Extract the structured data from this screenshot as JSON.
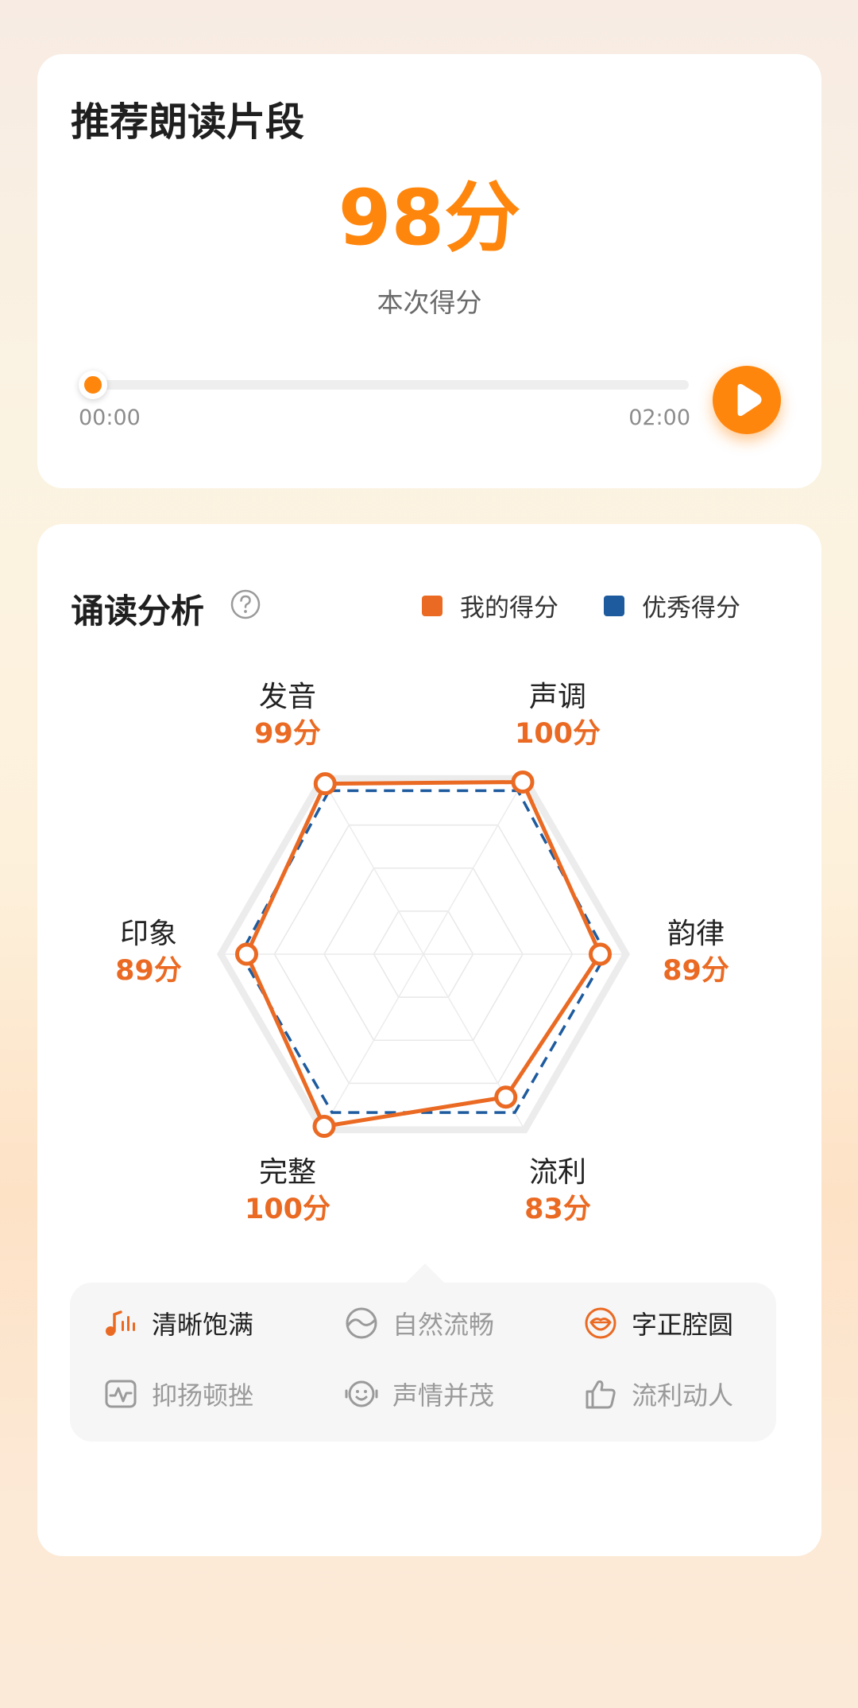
{
  "recommend_card": {
    "title": "推荐朗读片段",
    "score": "98分",
    "score_label": "本次得分",
    "progress_fraction": 0,
    "time_start": "00:00",
    "time_end": "02:00"
  },
  "analysis": {
    "title": "诵读分析",
    "legend": [
      {
        "label": "我的得分",
        "color": "#ea6a23"
      },
      {
        "label": "优秀得分",
        "color": "#1e5b9e"
      }
    ]
  },
  "chart_data": {
    "type": "radar",
    "max": 100,
    "axes": [
      {
        "label": "发音",
        "value": 99,
        "value_label": "99分"
      },
      {
        "label": "声调",
        "value": 100,
        "value_label": "100分"
      },
      {
        "label": "韵律",
        "value": 89,
        "value_label": "89分"
      },
      {
        "label": "流利",
        "value": 83,
        "value_label": "83分"
      },
      {
        "label": "完整",
        "value": 100,
        "value_label": "100分"
      },
      {
        "label": "印象",
        "value": 89,
        "value_label": "89分"
      }
    ],
    "series": [
      {
        "name": "我的得分",
        "values": [
          99,
          100,
          89,
          83,
          100,
          89
        ],
        "color": "#ea6a23"
      },
      {
        "name": "优秀得分",
        "values": [
          95,
          95,
          92,
          92,
          92,
          92
        ],
        "color": "#1e5b9e"
      }
    ]
  },
  "features": [
    {
      "label": "清晰饱满",
      "icon": "music-note-icon",
      "active": true
    },
    {
      "label": "自然流畅",
      "icon": "flow-circle-icon",
      "active": false
    },
    {
      "label": "字正腔圆",
      "icon": "lips-icon",
      "active": true
    },
    {
      "label": "抑扬顿挫",
      "icon": "pulse-icon",
      "active": false
    },
    {
      "label": "声情并茂",
      "icon": "smile-face-icon",
      "active": false
    },
    {
      "label": "流利动人",
      "icon": "thumbs-up-icon",
      "active": false
    }
  ],
  "colors": {
    "accent": "#ff860d",
    "mine": "#ea6a23",
    "excellent": "#1e5b9e"
  }
}
